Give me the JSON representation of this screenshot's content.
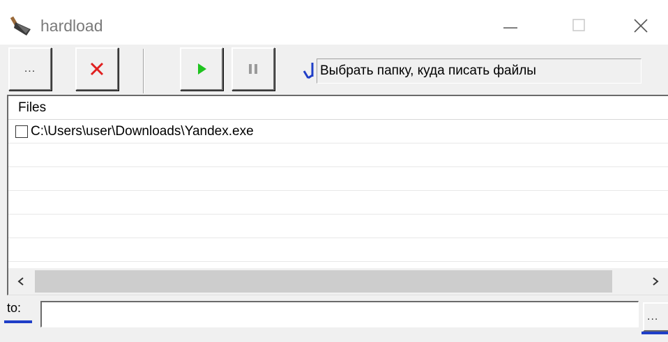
{
  "window": {
    "title": "hardload",
    "icon": "shovel-icon",
    "controls": [
      "minimize-icon",
      "maximize-icon",
      "close-icon"
    ]
  },
  "toolbar": {
    "browse_label": "...",
    "delete_icon": "red-x-icon",
    "play_icon": "green-play-icon",
    "pause_icon": "pause-icon",
    "status_icon": "blue-note-icon",
    "status_text": "Выбрать папку, куда писать файлы"
  },
  "list": {
    "column_header": "Files",
    "rows": [
      {
        "path": "C:\\Users\\user\\Downloads\\Yandex.exe",
        "checked": false
      }
    ]
  },
  "scrollbar": {
    "left_arrow": "‹",
    "right_arrow": "›"
  },
  "destination": {
    "label": "to:",
    "value": "",
    "browse_label": "..."
  },
  "colors": {
    "delete": "#e02020",
    "play": "#1fc31f",
    "accent_blue": "#1f3ec7"
  }
}
